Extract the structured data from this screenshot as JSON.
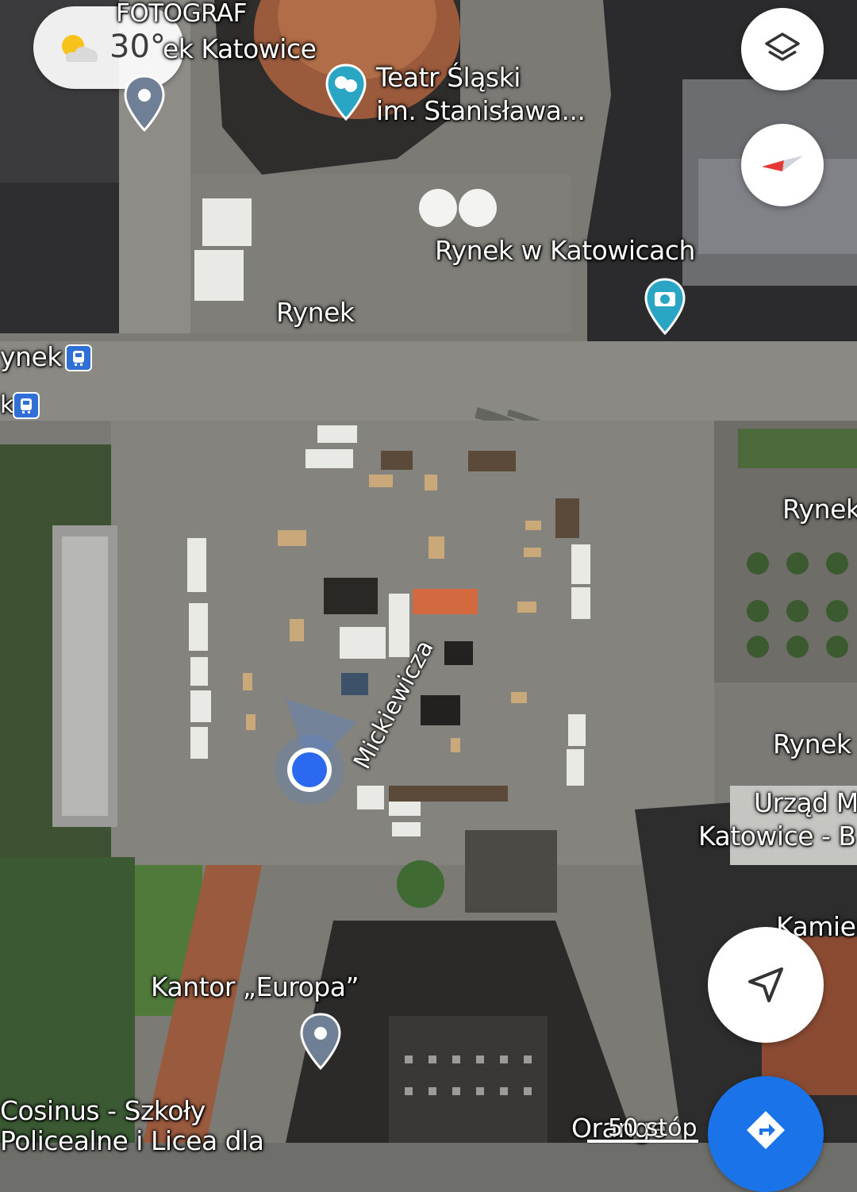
{
  "weather": {
    "temperature": "30°"
  },
  "labels": {
    "fotograf_line1": "FOTOGRAF",
    "fotograf_line2": "ek Katowice",
    "teatr_line1": "Teatr Śląski",
    "teatr_line2": "im. Stanisława...",
    "rynek_w_katowicach": "Rynek w Katowicach",
    "rynek_square": "Rynek",
    "rynek_stop_left": "ynek",
    "rynek_stop_left2": "k",
    "rynek_right_top": "Rynek",
    "rynek_right_bottom": "Rynek",
    "urzad_line1": "Urząd M",
    "urzad_line2": "Katowice - B",
    "kamien": "Kamien",
    "kantor": "Kantor „Europa”",
    "cosinus_line1": "Cosinus - Szkoły",
    "cosinus_line2": "Policealne i Licea dla",
    "orange": "Orange",
    "street_mickiewicza": "Mickiewicza"
  },
  "scale": {
    "label": "50 stóp"
  },
  "icons": {
    "layers": "layers-icon",
    "compass": "compass-icon",
    "my_location": "navigation-arrow-icon",
    "directions": "directions-icon",
    "weather": "partly-sunny-icon",
    "theater": "theater-masks-icon",
    "camera": "camera-icon",
    "tram": "tram-icon",
    "pin": "place-pin-icon",
    "location_dot": "current-location-dot"
  },
  "colors": {
    "accent_blue": "#1a73e8",
    "location_blue": "#2b6af0",
    "pin_teal": "#2aa6c4",
    "pin_gray": "#6f7f95",
    "compass_red": "#e53935"
  }
}
